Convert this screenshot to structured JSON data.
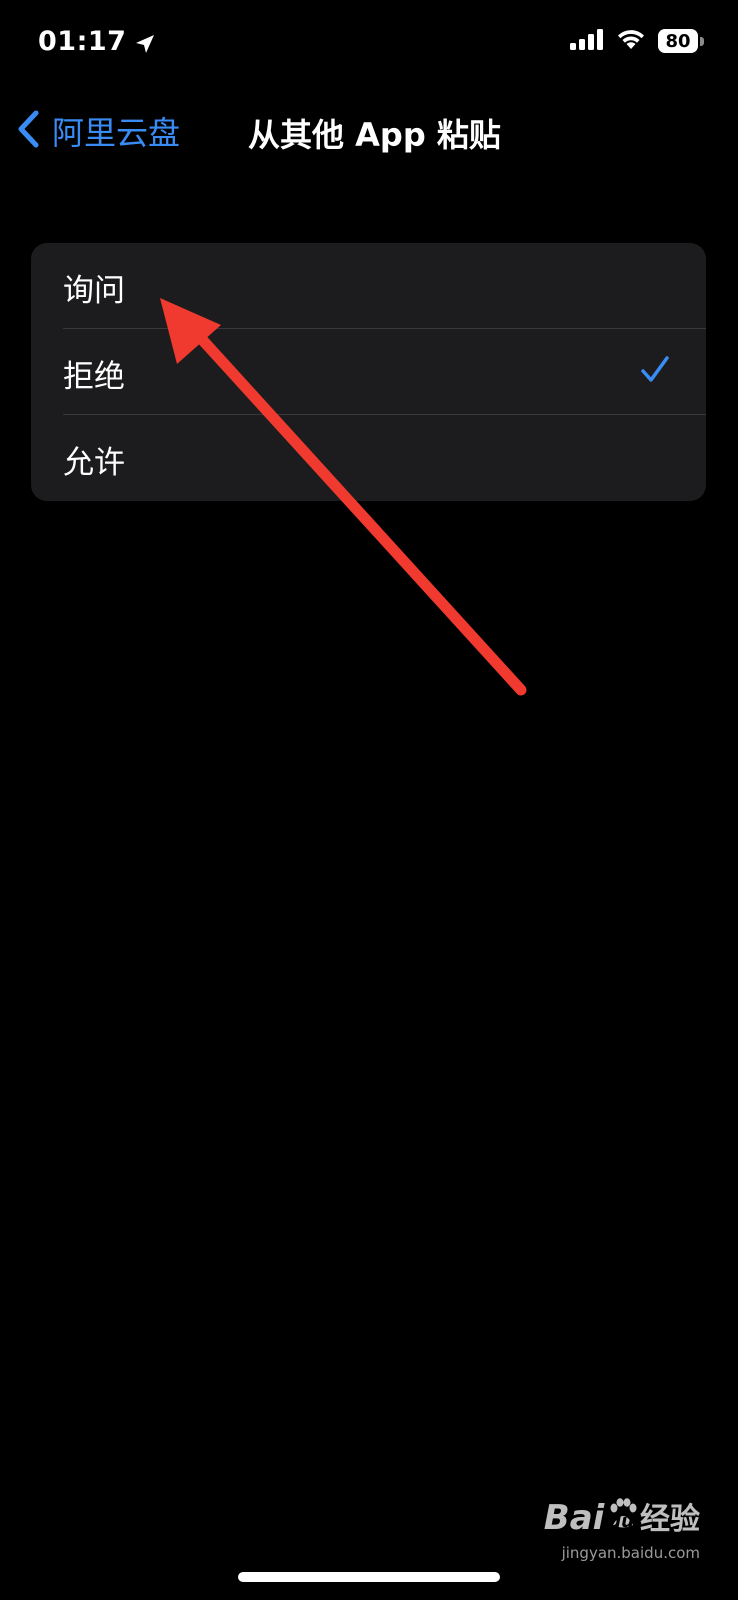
{
  "status_bar": {
    "time": "01:17",
    "battery_level": "80",
    "location_icon": "location-arrow-icon",
    "signal_icon": "cellular-signal-icon",
    "wifi_icon": "wifi-icon"
  },
  "nav": {
    "back_label": "阿里云盘",
    "title": "从其他 App 粘贴",
    "back_icon": "chevron-left-icon"
  },
  "options": [
    {
      "label": "询问",
      "selected": false
    },
    {
      "label": "拒绝",
      "selected": true
    },
    {
      "label": "允许",
      "selected": false
    }
  ],
  "colors": {
    "accent": "#3a8cf5",
    "background": "#000000",
    "group_background": "#1c1c1e",
    "annotation": "#f03a2f"
  },
  "watermark": {
    "logo": "Bai",
    "logo_suffix": "du",
    "text": "经验",
    "url": "jingyan.baidu.com"
  }
}
